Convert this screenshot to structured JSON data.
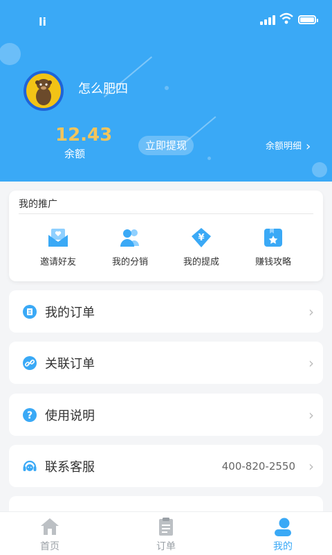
{
  "status_bar": {
    "carrier": "li"
  },
  "profile": {
    "username": "怎么肥四"
  },
  "balance": {
    "amount": "12.43",
    "label": "余额",
    "withdraw_button": "立即提现",
    "detail_link": "余额明细"
  },
  "promotion": {
    "title": "我的推广",
    "items": [
      {
        "label": "邀请好友",
        "icon": "envelope-heart-icon"
      },
      {
        "label": "我的分销",
        "icon": "users-icon"
      },
      {
        "label": "我的提成",
        "icon": "yuan-tag-icon"
      },
      {
        "label": "赚钱攻略",
        "icon": "star-bookmark-icon"
      }
    ]
  },
  "menu": [
    {
      "label": "我的订单",
      "icon": "order-icon"
    },
    {
      "label": "关联订单",
      "icon": "link-icon"
    },
    {
      "label": "使用说明",
      "icon": "help-icon"
    },
    {
      "label": "联系客服",
      "icon": "headset-icon",
      "value": "400-820-2550"
    }
  ],
  "tabbar": {
    "items": [
      {
        "label": "首页",
        "icon": "home-icon",
        "active": false
      },
      {
        "label": "订单",
        "icon": "clipboard-icon",
        "active": false
      },
      {
        "label": "我的",
        "icon": "user-icon",
        "active": true
      }
    ]
  },
  "colors": {
    "primary": "#3aa9f6",
    "balance_gold": "#f3c55c"
  }
}
